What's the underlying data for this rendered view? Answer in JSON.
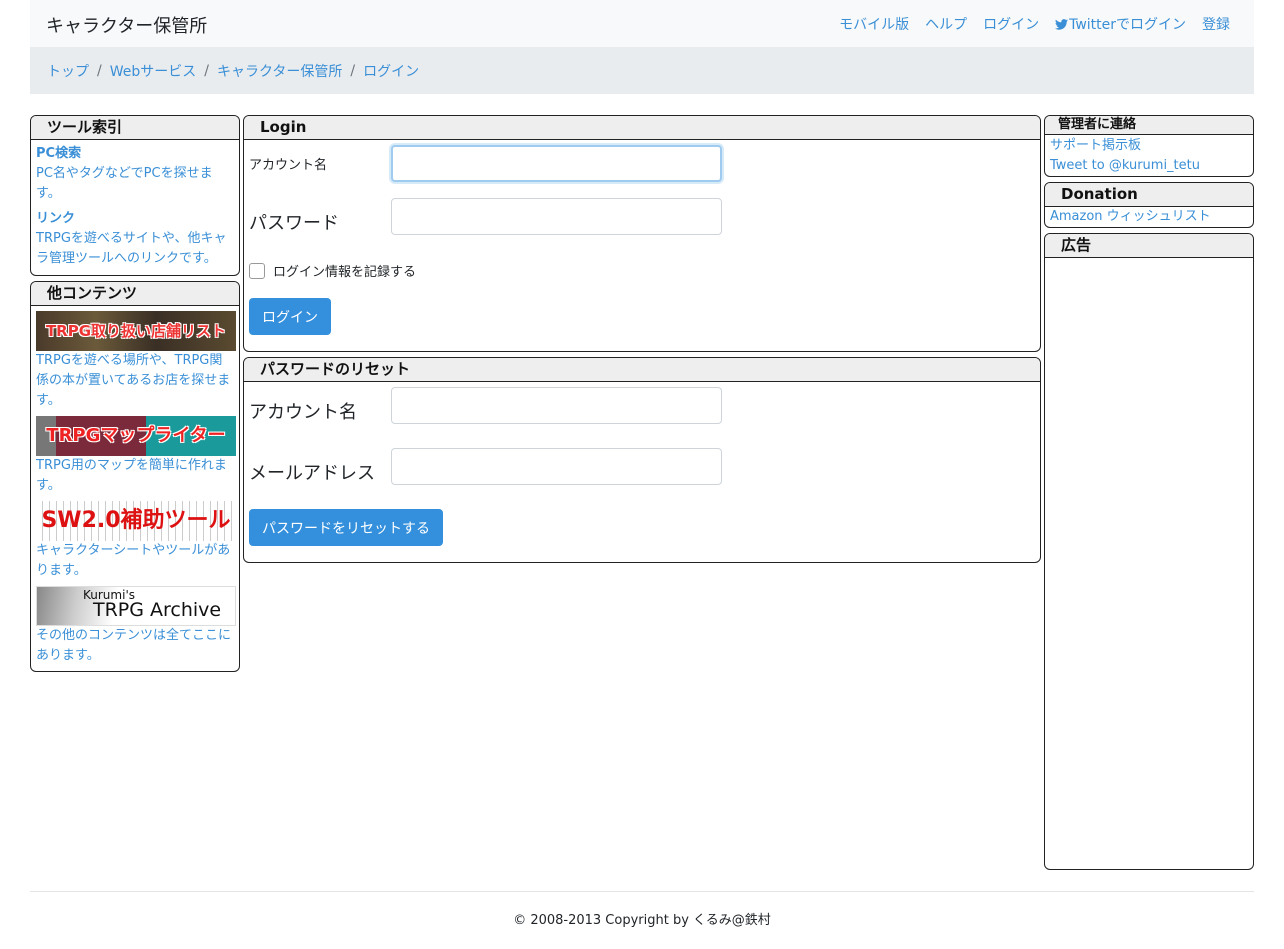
{
  "header": {
    "brand": "キャラクター保管所",
    "nav": [
      "モバイル版",
      "ヘルプ",
      "ログイン",
      "Twitterでログイン",
      "登録"
    ]
  },
  "breadcrumb": [
    "トップ",
    "Webサービス",
    "キャラクター保管所",
    "ログイン"
  ],
  "left": {
    "tool_index": {
      "title": "ツール索引",
      "items": [
        {
          "title": "PC検索",
          "desc": "PC名やタグなどでPCを探せます。"
        },
        {
          "title": "リンク",
          "desc": "TRPGを遊べるサイトや、他キャラ管理ツールへのリンクです。"
        }
      ]
    },
    "other": {
      "title": "他コンテンツ",
      "items": [
        {
          "banner": "TRPG取り扱い店舗リスト",
          "desc": "TRPGを遊べる場所や、TRPG関係の本が置いてあるお店を探せます。"
        },
        {
          "banner": "TRPGマップライター",
          "desc": "TRPG用のマップを簡単に作れます。"
        },
        {
          "banner": "SW2.0補助ツール",
          "desc": "キャラクターシートやツールがあります。"
        },
        {
          "banner_small": "Kurumi's",
          "banner": "TRPG Archive",
          "desc": "その他のコンテンツは全てここにあります。"
        }
      ]
    }
  },
  "login": {
    "title": "Login",
    "account_label": "アカウント名",
    "password_label": "パスワード",
    "remember_label": "ログイン情報を記録する",
    "submit": "ログイン"
  },
  "reset": {
    "title": "パスワードのリセット",
    "account_label": "アカウント名",
    "email_label": "メールアドレス",
    "submit": "パスワードをリセットする"
  },
  "right": {
    "contact": {
      "title": "管理者に連絡",
      "links": [
        "サポート掲示板",
        "Tweet to @kurumi_tetu"
      ]
    },
    "donation": {
      "title": "Donation",
      "links": [
        "Amazon ウィッシュリスト"
      ]
    },
    "ads": {
      "title": "広告"
    }
  },
  "footer": "© 2008-2013 Copyright by くるみ@鉄村"
}
